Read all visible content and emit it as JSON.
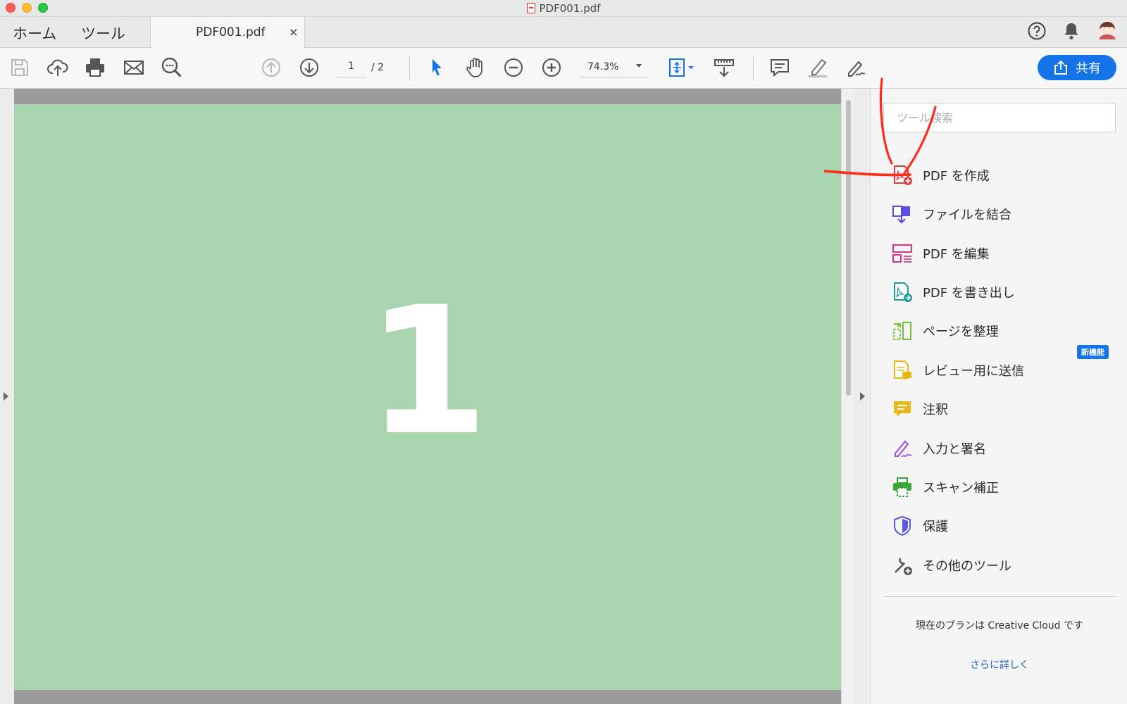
{
  "window": {
    "title": "PDF001.pdf"
  },
  "tabs": {
    "home": "ホーム",
    "tools": "ツール",
    "document": "PDF001.pdf",
    "close": "×"
  },
  "header_icons": [
    "help-icon",
    "notification-bell-icon",
    "user-avatar"
  ],
  "toolbar": {
    "icons": [
      "save-icon",
      "upload-cloud-icon",
      "print-icon",
      "mail-icon",
      "search-zoom-icon",
      "page-up-icon",
      "page-down-icon",
      "select-arrow-icon",
      "hand-icon",
      "zoom-out-icon",
      "zoom-in-icon",
      "fit-page-icon",
      "scroll-mode-icon",
      "comment-icon",
      "highlight-icon",
      "sign-icon"
    ],
    "page_current": "1",
    "page_total": "/ 2",
    "zoom": "74.3%",
    "share_label": "共有"
  },
  "document": {
    "page_number": "1",
    "page_color": "#a8d5ad"
  },
  "tools_pane": {
    "search_placeholder": "ツール検索",
    "items": [
      {
        "label": "PDF を作成",
        "icon": "create-pdf-icon",
        "color": "#e03b3b"
      },
      {
        "label": "ファイルを結合",
        "icon": "combine-files-icon",
        "color": "#5a4de0"
      },
      {
        "label": "PDF を編集",
        "icon": "edit-pdf-icon",
        "color": "#e0348a"
      },
      {
        "label": "PDF を書き出し",
        "icon": "export-pdf-icon",
        "color": "#1f9c9c"
      },
      {
        "label": "ページを整理",
        "icon": "organize-pages-icon",
        "color": "#74c12f"
      },
      {
        "label": "レビュー用に送信",
        "icon": "send-for-review-icon",
        "color": "#e8b817"
      },
      {
        "label": "注釈",
        "icon": "comment-tool-icon",
        "color": "#e8b817"
      },
      {
        "label": "入力と署名",
        "icon": "fill-sign-icon",
        "color": "#9b4de0"
      },
      {
        "label": "スキャン補正",
        "icon": "scan-ocr-icon",
        "color": "#3aa63a"
      },
      {
        "label": "保護",
        "icon": "protect-shield-icon",
        "color": "#5a5ae0"
      },
      {
        "label": "その他のツール",
        "icon": "more-tools-icon",
        "color": "#555555"
      }
    ],
    "new_badge": "新機能",
    "plan_text": "現在のプランは Creative Cloud です",
    "learn_more": "さらに詳しく"
  },
  "colors": {
    "accent": "#1473e6",
    "annotation": "#ff2a1a"
  }
}
